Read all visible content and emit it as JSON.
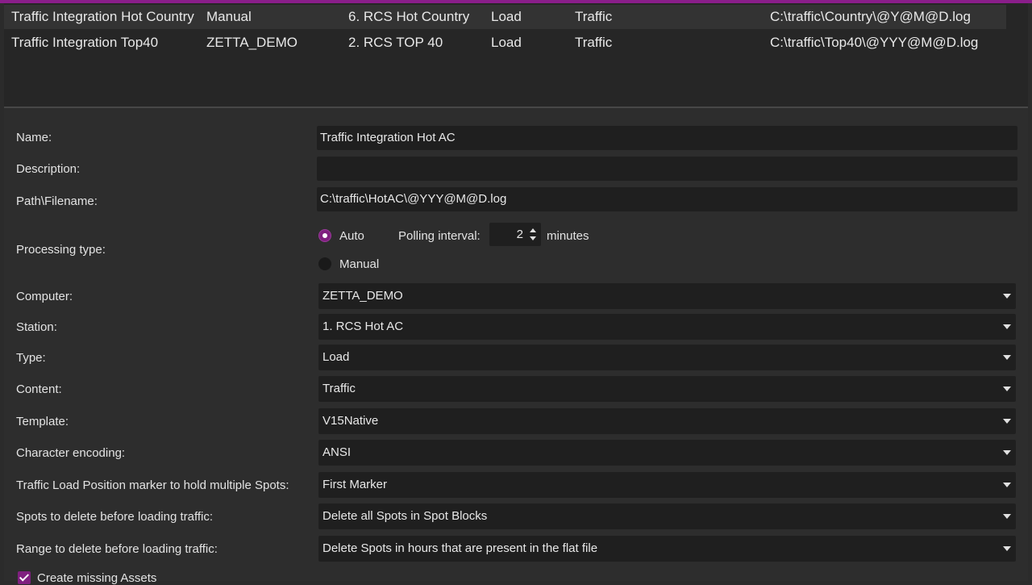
{
  "list": {
    "rows": [
      {
        "name": "Traffic Integration Hot Country",
        "computer": "Manual",
        "station": "6. RCS Hot Country",
        "type": "Load",
        "content": "Traffic",
        "path": "C:\\traffic\\Country\\@Y@M@D.log"
      },
      {
        "name": "Traffic Integration Top40",
        "computer": "ZETTA_DEMO",
        "station": "2. RCS TOP 40",
        "type": "Load",
        "content": "Traffic",
        "path": "C:\\traffic\\Top40\\@YYY@M@D.log"
      }
    ]
  },
  "form": {
    "name_label": "Name:",
    "name_value": "Traffic Integration Hot AC",
    "description_label": "Description:",
    "description_value": "",
    "path_label": "Path\\Filename:",
    "path_value": "C:\\traffic\\HotAC\\@YYY@M@D.log",
    "processing_label": "Processing type:",
    "auto_label": "Auto",
    "manual_label": "Manual",
    "polling_label": "Polling interval:",
    "polling_value": "2",
    "minutes_label": "minutes",
    "computer_label": "Computer:",
    "computer_value": "ZETTA_DEMO",
    "station_label": "Station:",
    "station_value": "1. RCS Hot AC",
    "type_label": "Type:",
    "type_value": "Load",
    "content_label": "Content:",
    "content_value": "Traffic",
    "template_label": "Template:",
    "template_value": "V15Native",
    "encoding_label": "Character encoding:",
    "encoding_value": "ANSI",
    "marker_label": "Traffic Load Position marker to hold multiple Spots:",
    "marker_value": "First Marker",
    "spots_label": "Spots to delete before loading traffic:",
    "spots_value": "Delete all Spots in Spot Blocks",
    "range_label": "Range to delete before loading traffic:",
    "range_value": "Delete Spots in hours that are present in the flat file",
    "create_assets_label": "Create missing Assets"
  }
}
